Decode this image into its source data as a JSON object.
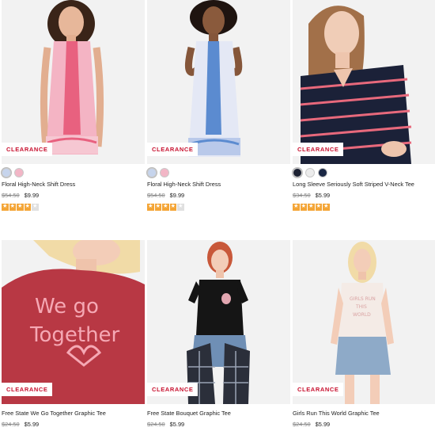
{
  "products": [
    {
      "badge": "CLEARANCE",
      "name": "Floral High-Neck Shift Dress",
      "old_price": "$54.50",
      "price": "$9.99",
      "rating": 4,
      "max_rating": 5,
      "swatches": [
        "#c6d4ec",
        "#f2b6c6"
      ],
      "dress_color": "#f28ca6",
      "panel_color": "#e8617f"
    },
    {
      "badge": "CLEARANCE",
      "name": "Floral High-Neck Shift Dress",
      "old_price": "$54.50",
      "price": "$9.99",
      "rating": 4,
      "max_rating": 5,
      "swatches": [
        "#c6d4ec",
        "#f2b6c6"
      ],
      "dress_color": "#dfe3f4",
      "panel_color": "#5b8bd0"
    },
    {
      "badge": "CLEARANCE",
      "name": "Long Sleeve Seriously Soft Striped V-Neck Tee",
      "old_price": "$34.50",
      "price": "$5.99",
      "rating": 5,
      "max_rating": 5,
      "swatches": [
        "#1d2233",
        "#d9d9d9",
        "#1a2744"
      ],
      "dress_color": "#1b2138",
      "panel_color": "#e8697c"
    },
    {
      "badge": "CLEARANCE",
      "name": "Free State We Go Together Graphic Tee",
      "old_price": "$24.50",
      "price": "$5.99",
      "graphic_lines": [
        "We go",
        "Together"
      ],
      "dress_color": "#b83844",
      "panel_color": "#f5a8b4"
    },
    {
      "badge": "CLEARANCE",
      "name": "Free State Bouquet Graphic Tee",
      "old_price": "$24.50",
      "price": "$5.99",
      "dress_color": "#151515",
      "panel_color": "#6f8fb5"
    },
    {
      "badge": "CLEARANCE",
      "name": "Girls Run This World Graphic Tee",
      "old_price": "$24.50",
      "price": "$5.99",
      "graphic_lines": [
        "GIRLS RUN",
        "THIS",
        "WORLD"
      ],
      "dress_color": "#f4ebe6",
      "panel_color": "#8eaac8"
    }
  ]
}
